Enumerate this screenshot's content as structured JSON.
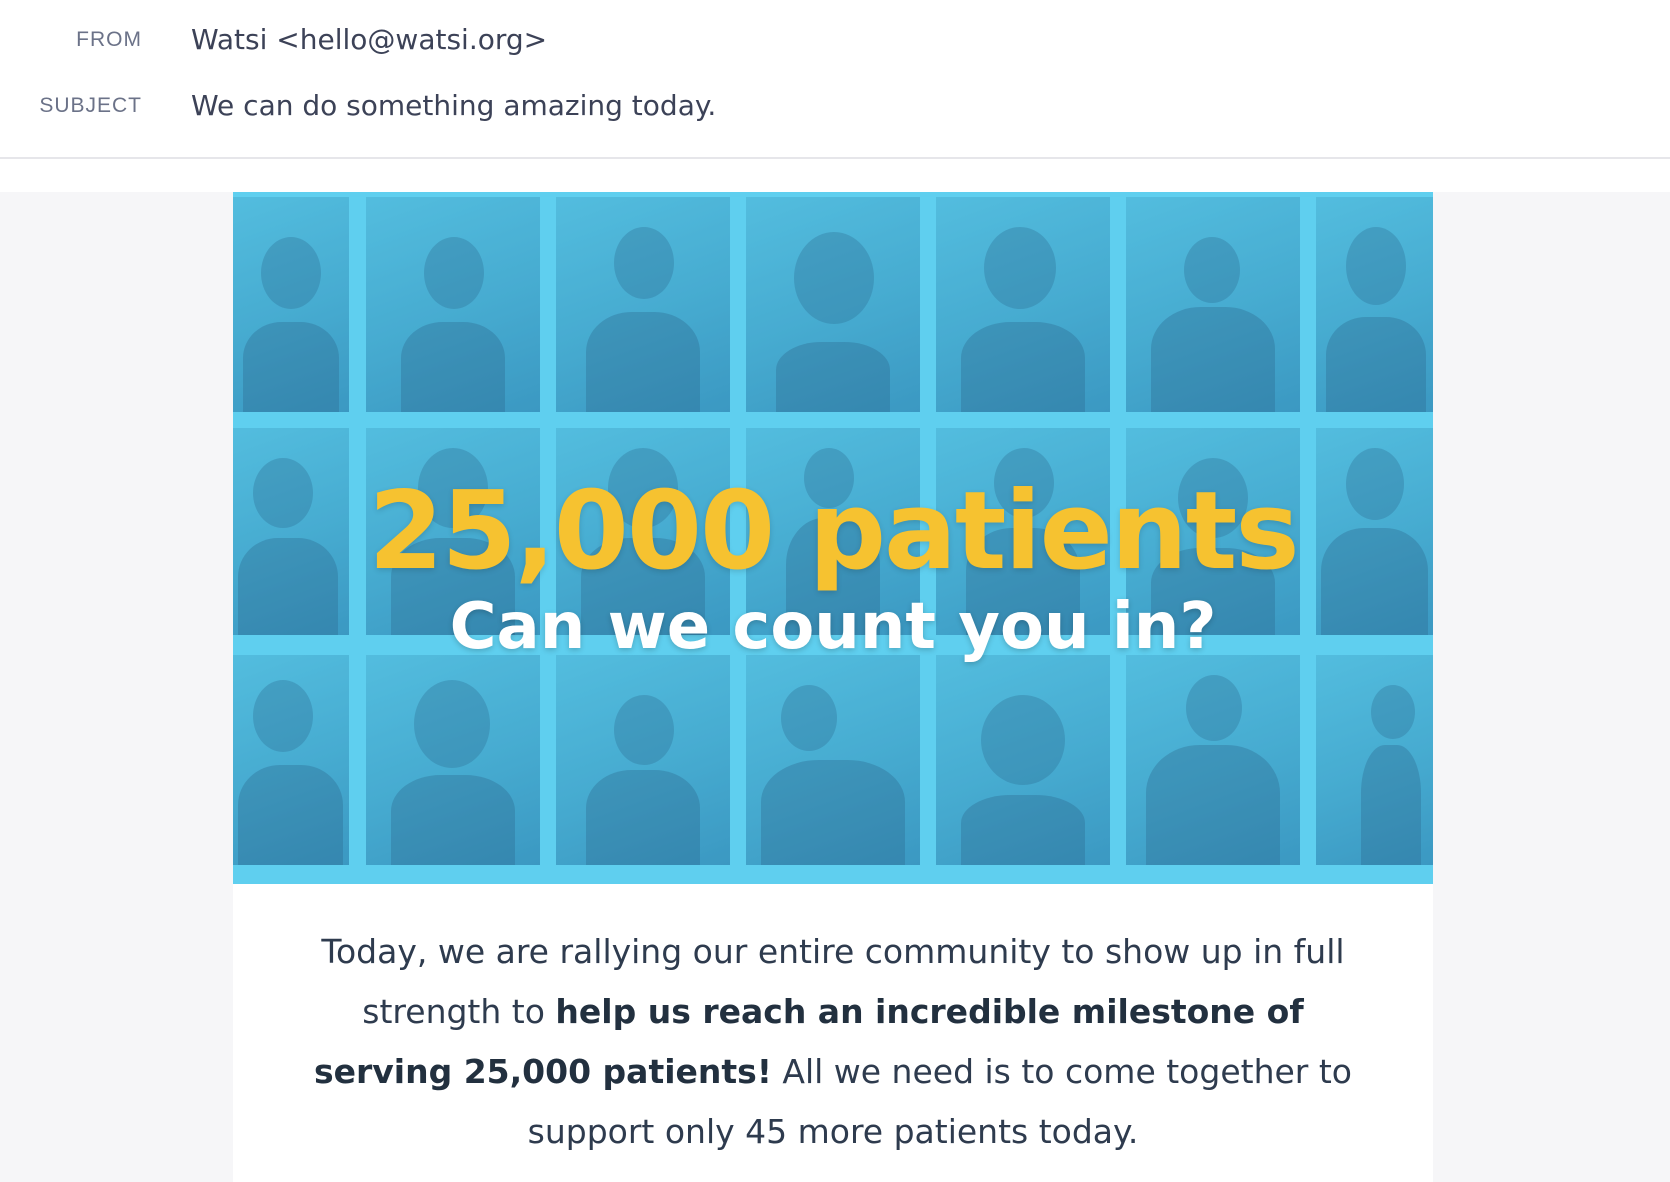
{
  "email": {
    "from_label": "FROM",
    "from_value": "Watsi <hello@watsi.org>",
    "subject_label": "SUBJECT",
    "subject_value": "We can do something amazing today."
  },
  "hero": {
    "title": "25,000 patients",
    "subtitle": "Can we count you in?",
    "background_color": "#5fcfef",
    "title_color": "#f6c230"
  },
  "body": {
    "intro_part1": "Today, we are rallying our entire community to show up in full strength to ",
    "intro_bold": "help us reach an incredible milestone of serving 25,000 patients!",
    "intro_part2": " All we need is to come together to support only 45 more patients today."
  }
}
